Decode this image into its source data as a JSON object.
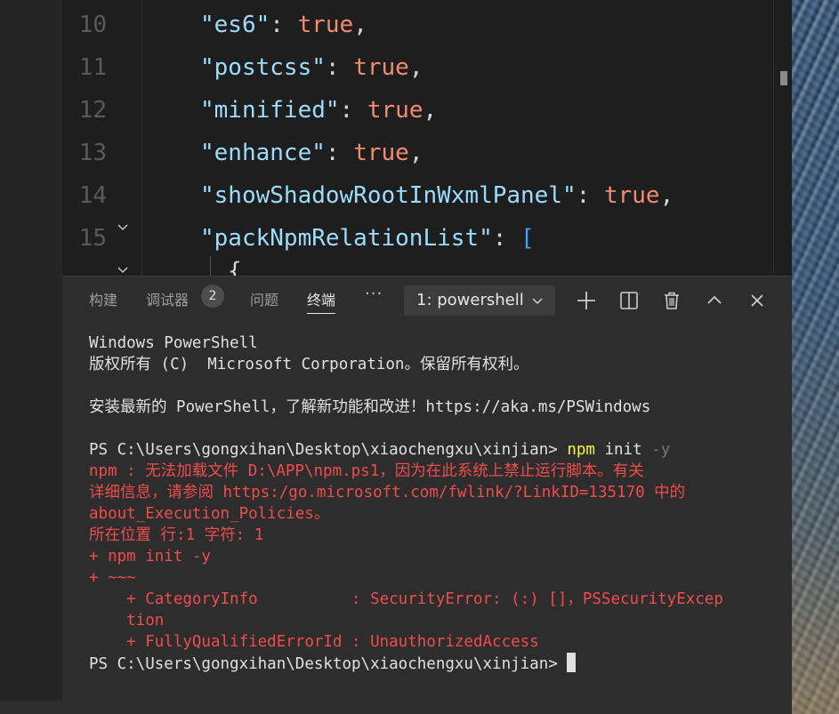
{
  "editor": {
    "lines": [
      {
        "num": "10",
        "key": "\"es6\"",
        "sep": ": ",
        "val": "true",
        "end": ","
      },
      {
        "num": "11",
        "key": "\"postcss\"",
        "sep": ": ",
        "val": "true",
        "end": ","
      },
      {
        "num": "12",
        "key": "\"minified\"",
        "sep": ": ",
        "val": "true",
        "end": ","
      },
      {
        "num": "13",
        "key": "\"enhance\"",
        "sep": ": ",
        "val": "true",
        "end": ","
      },
      {
        "num": "14",
        "key": "\"showShadowRootInWxmlPanel\"",
        "sep": ": ",
        "val": "true",
        "end": ","
      },
      {
        "num": "15",
        "key": "\"packNpmRelationList\"",
        "sep": ": ",
        "val": "[",
        "end": ""
      }
    ],
    "partial_line": "{"
  },
  "panel": {
    "tabs": [
      "构建",
      "调试器",
      "问题",
      "终端"
    ],
    "debug_badge": "2",
    "more": "···",
    "terminal_select": "1: powershell"
  },
  "terminal": {
    "l1": "Windows PowerShell",
    "l2": "版权所有 (C)  Microsoft Corporation。保留所有权利。",
    "l3": "安装最新的 PowerShell，了解新功能和改进！https://aka.ms/PSWindows",
    "prompt": "PS C:\\Users\\gongxihan\\Desktop\\xiaochengxu\\xinjian> ",
    "cmd_npm": "npm",
    "cmd_init": " init ",
    "cmd_flag": "-y",
    "e1": "npm : 无法加载文件 D:\\APP\\npm.ps1，因为在此系统上禁止运行脚本。有关",
    "e2": "详细信息，请参阅 https:/go.microsoft.com/fwlink/?LinkID=135170 中的",
    "e3": "about_Execution_Policies。",
    "e4": "所在位置 行:1 字符: 1",
    "e5": "+ npm init -y",
    "e6": "+ ~~~",
    "e7": "    + CategoryInfo          : SecurityError: (:) []，PSSecurityExcep",
    "e8": "    tion",
    "e9": "    + FullyQualifiedErrorId : UnauthorizedAccess",
    "prompt2": "PS C:\\Users\\gongxihan\\Desktop\\xiaochengxu\\xinjian> "
  },
  "colors": {
    "error": "#f14c4c",
    "command": "#f5f543",
    "boolean": "#f28b6f",
    "key": "#9cdcfe"
  }
}
